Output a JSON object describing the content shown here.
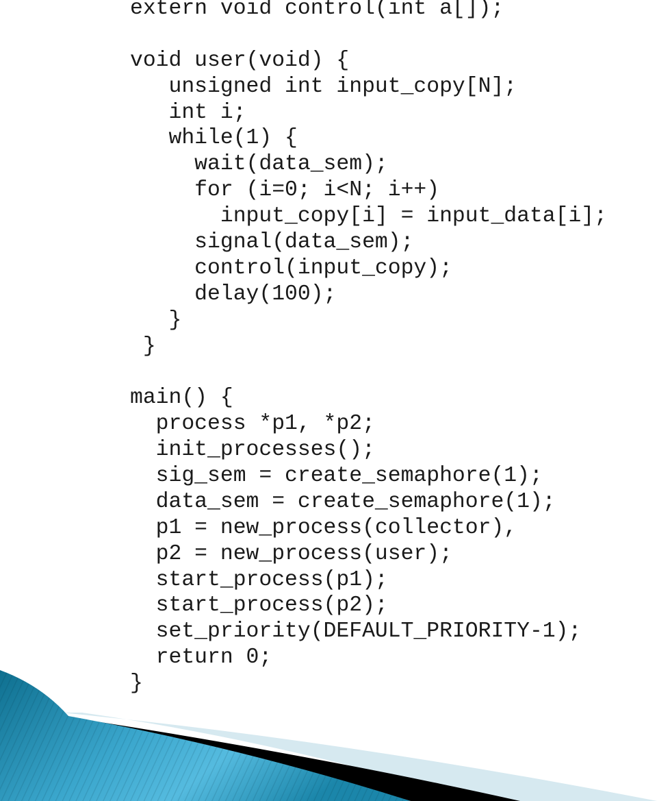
{
  "slide": {
    "code_lines": [
      "extern void control(int a[]);",
      "",
      "void user(void) {",
      "   unsigned int input_copy[N];",
      "   int i;",
      "   while(1) {",
      "     wait(data_sem);",
      "     for (i=0; i<N; i++)",
      "       input_copy[i] = input_data[i];",
      "     signal(data_sem);",
      "     control(input_copy);",
      "     delay(100);",
      "   }",
      " }",
      "",
      "main() {",
      "  process *p1, *p2;",
      "  init_processes();",
      "  sig_sem = create_semaphore(1);",
      "  data_sem = create_semaphore(1);",
      "  p1 = new_process(collector),",
      "  p2 = new_process(user);",
      "  start_process(p1);",
      "  start_process(p2);",
      "  set_priority(DEFAULT_PRIORITY-1);",
      "  return 0;",
      "}"
    ],
    "decoration": {
      "wave_colors": {
        "blue_dark": "#0f7090",
        "blue_light": "#4fb3d6",
        "black_band": "#000000",
        "pale_band": "#d6e9f0"
      }
    }
  }
}
